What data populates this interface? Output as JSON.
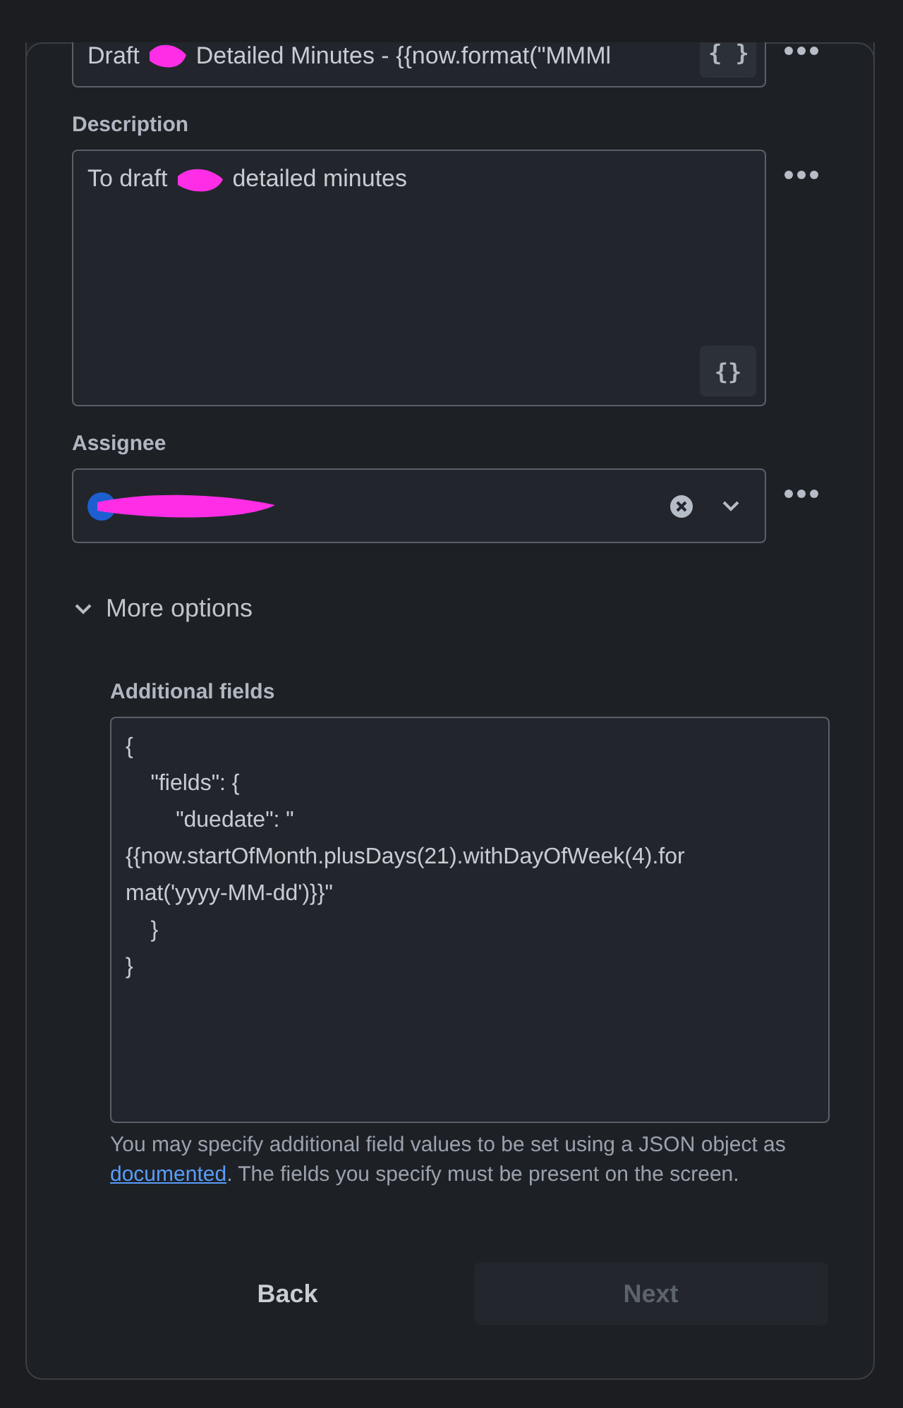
{
  "summary_field": {
    "value_parts": [
      "Draft",
      "Detailed Minutes - {{now.format(\"MMMl"
    ],
    "redacted": true,
    "template_button": "{ }"
  },
  "description": {
    "label": "Description",
    "value_parts": [
      "To draft",
      "detailed minutes"
    ],
    "redacted": true,
    "template_button": "{}"
  },
  "assignee": {
    "label": "Assignee",
    "redacted": true
  },
  "more_options": {
    "label": "More options",
    "expanded": true
  },
  "additional_fields": {
    "label": "Additional fields",
    "lines": [
      "{",
      "    \"fields\": {",
      "        \"duedate\": \"",
      "{{now.startOfMonth.plusDays(21).withDayOfWeek(4).for",
      "mat('yyyy-MM-dd')}}\"",
      "    }",
      "}"
    ],
    "help_parts": [
      "You may specify additional field values to be set using a JSON object as ",
      "documented",
      ". The fields you specify must be present on the screen."
    ]
  },
  "buttons": [
    {
      "label": "Back",
      "disabled": false,
      "kind": "plain"
    },
    {
      "label": "Next",
      "disabled": true,
      "kind": "filled"
    }
  ]
}
